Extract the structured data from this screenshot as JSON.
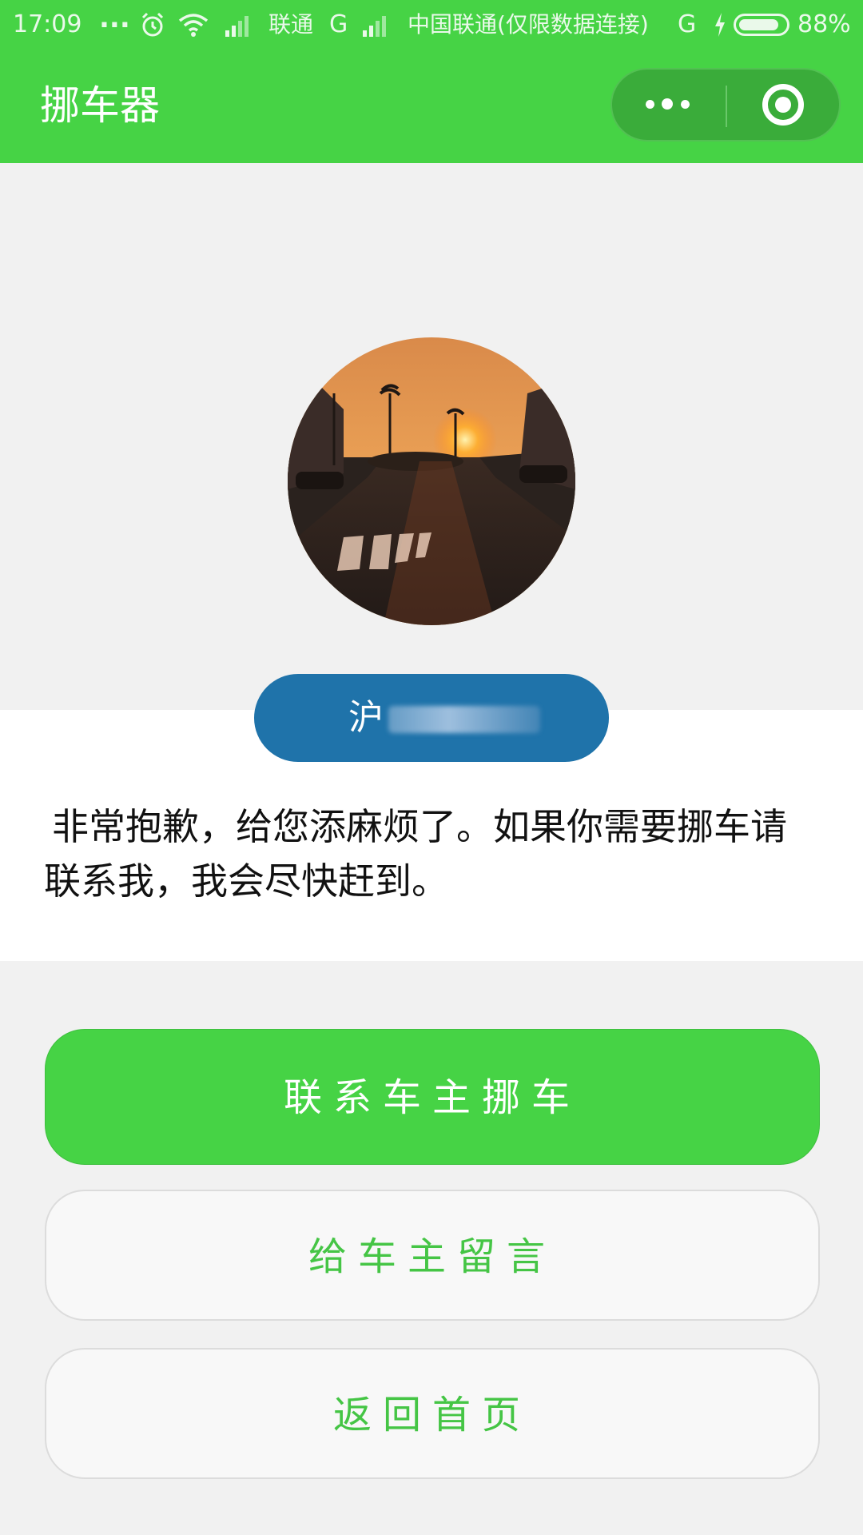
{
  "status_bar": {
    "time": "17:09",
    "dots": "...",
    "carrier1": "联通",
    "network1": "G",
    "carrier2": "中国联通(仅限数据连接)",
    "network2": "G",
    "battery_percent": "88%",
    "battery_level": 0.88
  },
  "header": {
    "title": "挪车器",
    "more_icon": "more-dots-icon",
    "close_icon": "target-circle-icon",
    "background_color": "#46d345"
  },
  "profile": {
    "avatar": "street-sunset-photo",
    "plate_prefix": "沪",
    "plate_color": "#1f73aa"
  },
  "message": "非常抱歉，给您添麻烦了。如果你需要挪车请联系我，我会尽快赶到。",
  "buttons": {
    "contact": "联系车主挪车",
    "leave_message": "给车主留言",
    "home": "返回首页"
  },
  "colors": {
    "accent": "#46d345",
    "background": "#f1f1f1"
  }
}
